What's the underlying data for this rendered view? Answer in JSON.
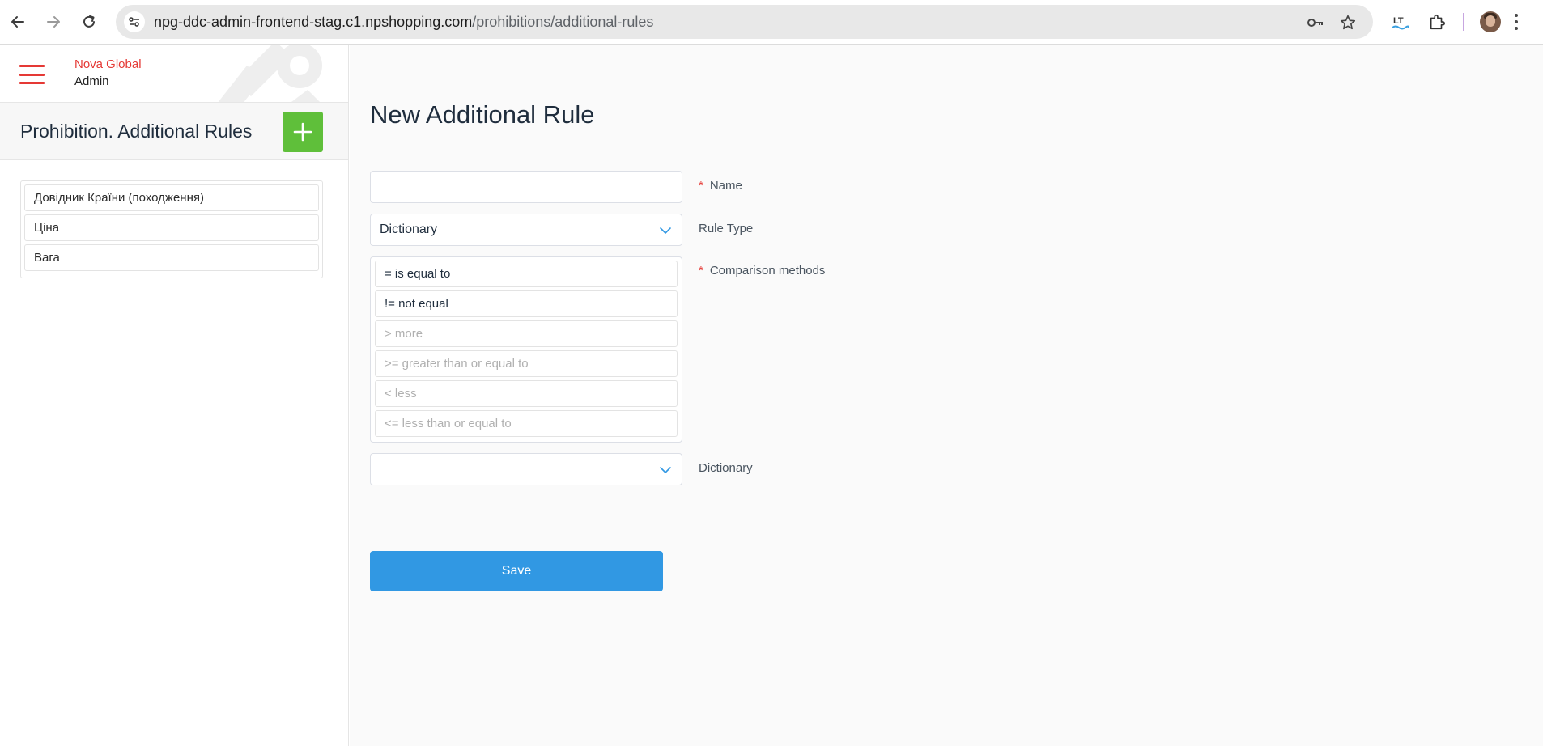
{
  "browser": {
    "url_host": "npg-ddc-admin-frontend-stag.c1.npshopping.com",
    "url_path": "/prohibitions/additional-rules",
    "icons": [
      "back-arrow-icon",
      "forward-arrow-icon",
      "reload-icon",
      "site-info-icon",
      "password-key-icon",
      "bookmark-star-icon",
      "languagetool-extension-icon",
      "extensions-puzzle-icon",
      "profile-avatar",
      "chrome-menu-icon"
    ]
  },
  "sidebar": {
    "brand_line1": "Nova Global",
    "brand_line2": "Admin",
    "title": "Prohibition. Additional Rules",
    "items": [
      {
        "label": "Довідник Країни (походження)"
      },
      {
        "label": "Ціна"
      },
      {
        "label": "Вага"
      }
    ]
  },
  "main": {
    "page_title": "New Additional Rule",
    "name_field": {
      "value": "",
      "label": "Name",
      "required": "*"
    },
    "rule_type": {
      "value": "Dictionary",
      "label": "Rule Type"
    },
    "comparison": {
      "label": "Comparison methods",
      "required": "*",
      "methods": [
        {
          "label": "= is equal to",
          "state": "active"
        },
        {
          "label": "!= not equal",
          "state": "active"
        },
        {
          "label": "> more",
          "state": "disabled"
        },
        {
          "label": ">= greater than or equal to",
          "state": "disabled"
        },
        {
          "label": "< less",
          "state": "disabled"
        },
        {
          "label": "<= less than or equal to",
          "state": "disabled"
        }
      ]
    },
    "dictionary": {
      "value": "",
      "label": "Dictionary"
    },
    "save_label": "Save"
  },
  "colors": {
    "brand_red": "#e53935",
    "add_green": "#5fbf3a",
    "save_blue": "#3198e3",
    "chevron_blue": "#3198e3"
  }
}
